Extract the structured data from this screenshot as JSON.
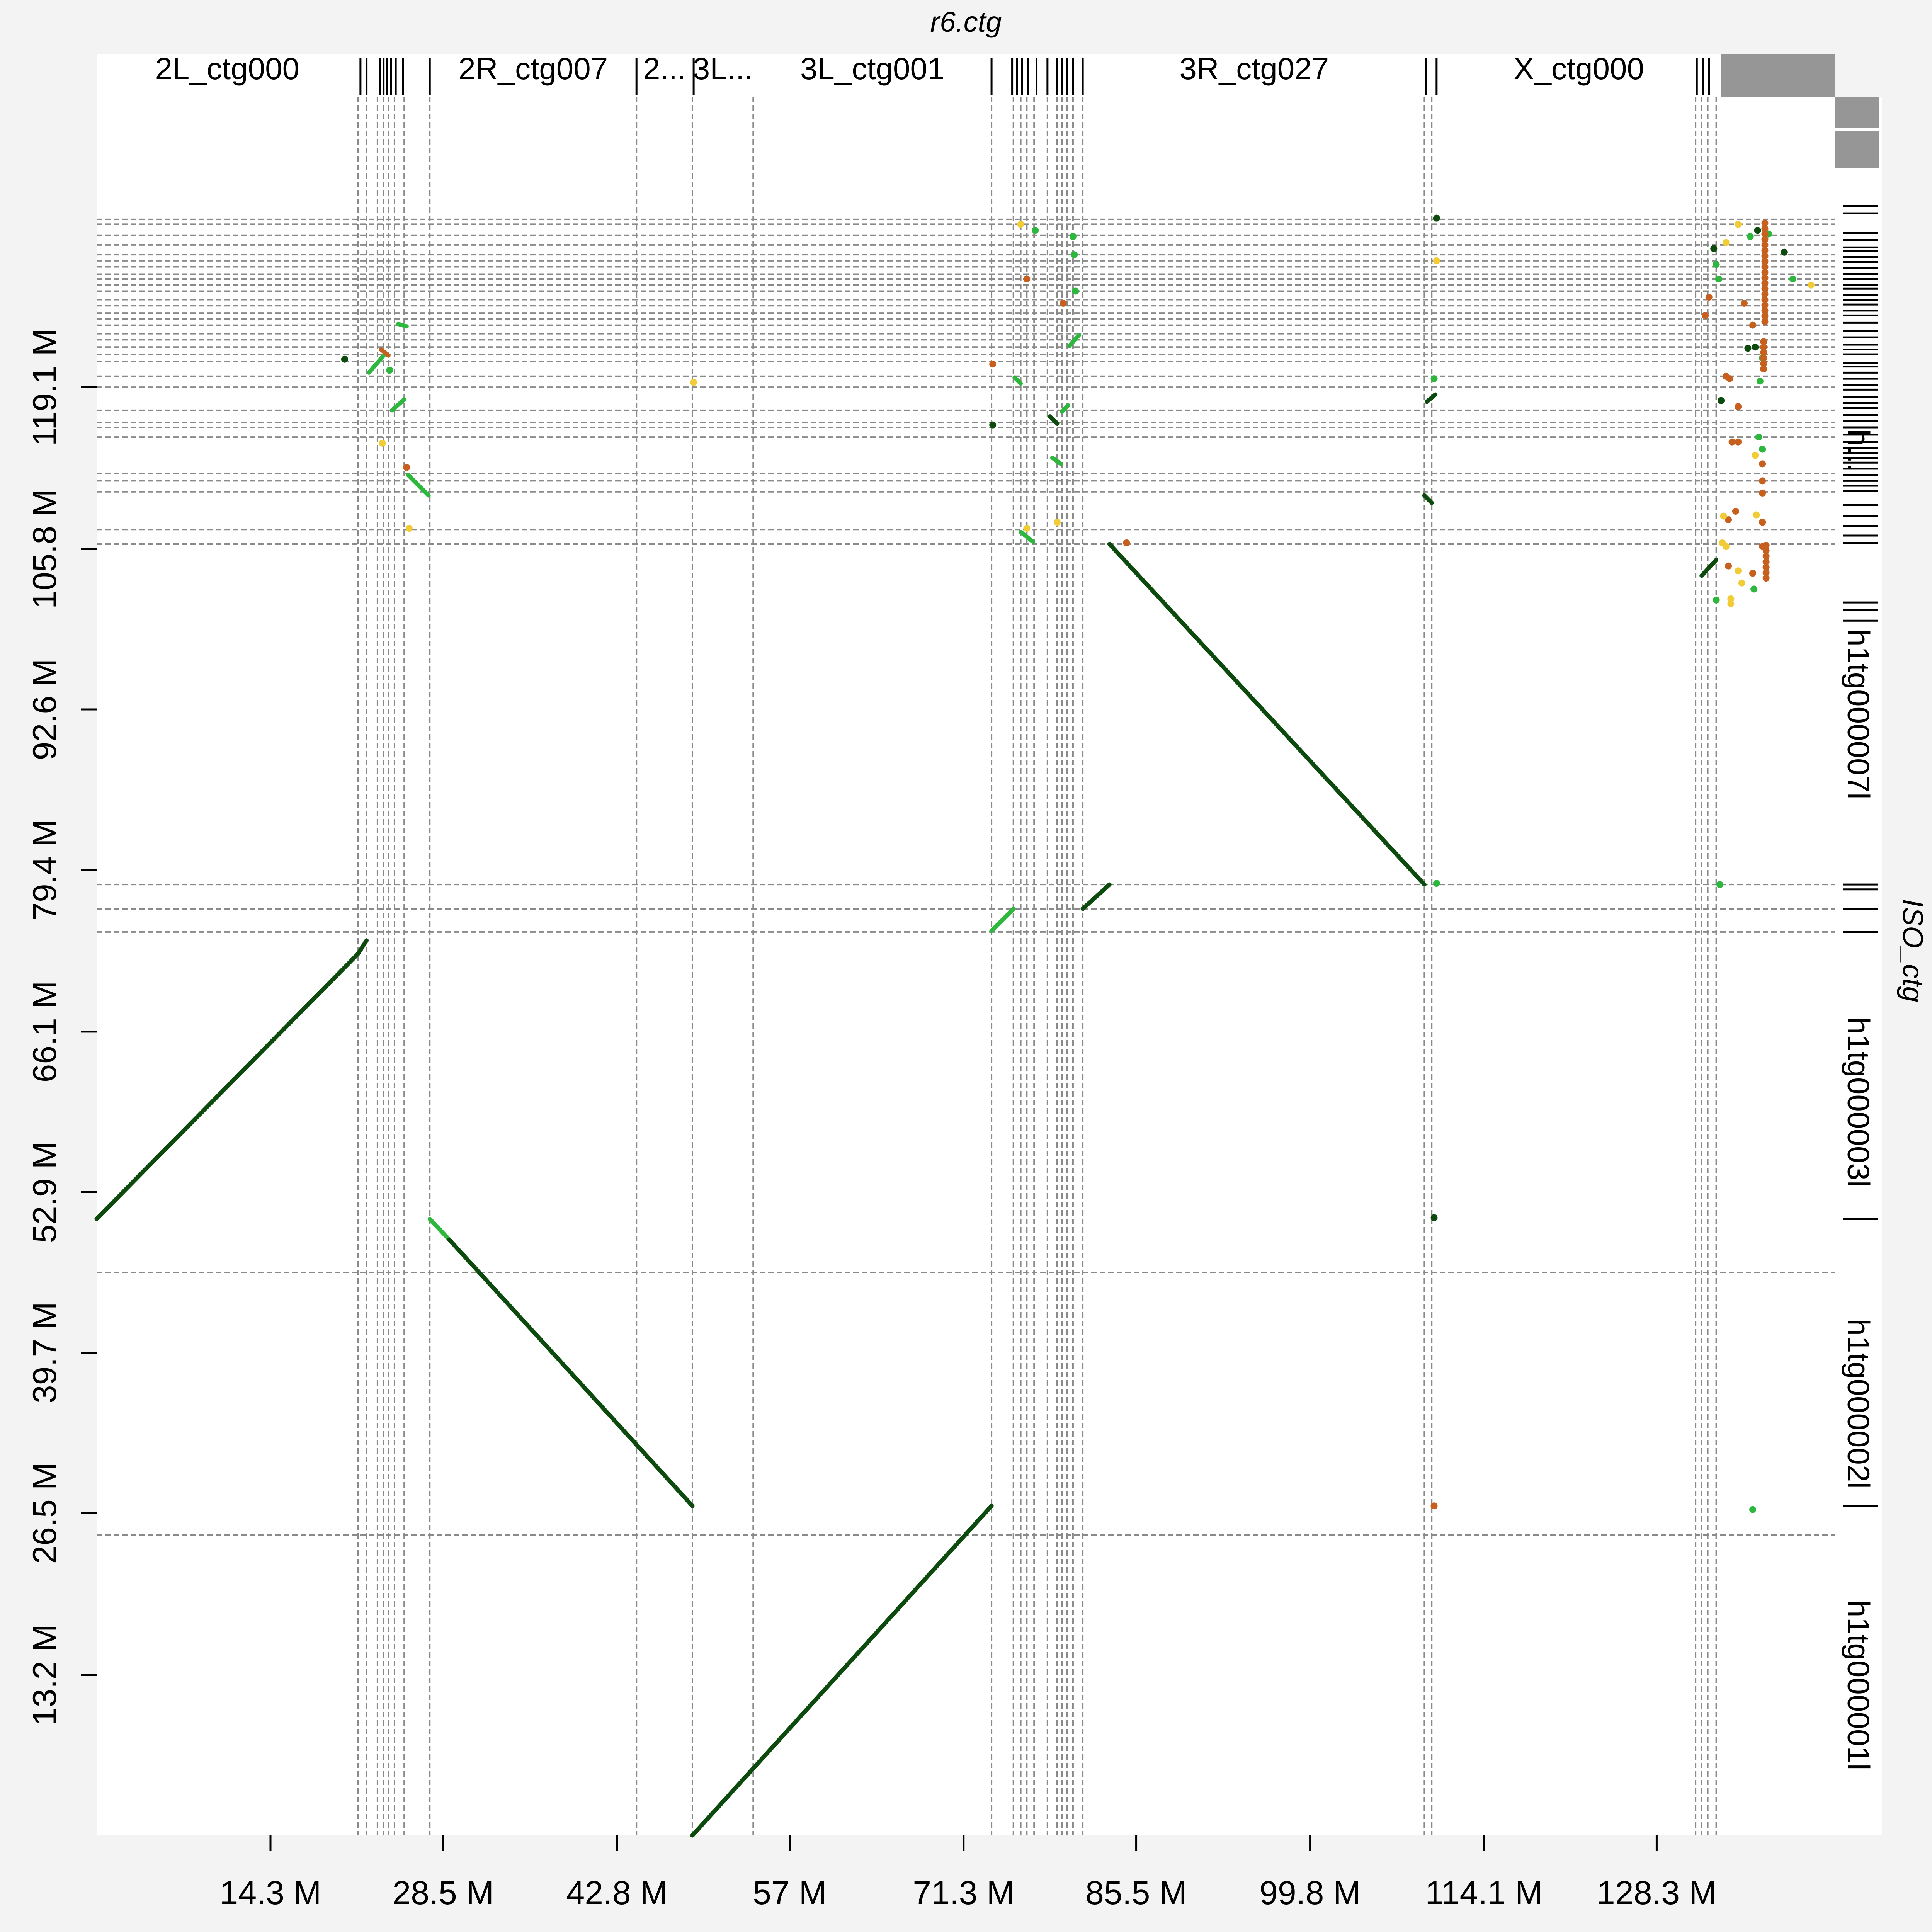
{
  "chart_data": {
    "type": "scatter",
    "title": "r6.ctg",
    "xlabel": "",
    "ylabel": "ISO_ctg",
    "xlim": [
      0,
      143
    ],
    "ylim": [
      0,
      143
    ],
    "x_ticks": [
      {
        "value": 14.3,
        "label": "14.3 M"
      },
      {
        "value": 28.5,
        "label": "28.5 M"
      },
      {
        "value": 42.8,
        "label": "42.8 M"
      },
      {
        "value": 57.0,
        "label": "57 M"
      },
      {
        "value": 71.3,
        "label": "71.3 M"
      },
      {
        "value": 85.5,
        "label": "85.5 M"
      },
      {
        "value": 99.8,
        "label": "99.8 M"
      },
      {
        "value": 114.1,
        "label": "114.1 M"
      },
      {
        "value": 128.3,
        "label": "128.3 M"
      }
    ],
    "y_ticks": [
      {
        "value": 13.2,
        "label": "13.2 M"
      },
      {
        "value": 26.5,
        "label": "26.5 M"
      },
      {
        "value": 39.7,
        "label": "39.7 M"
      },
      {
        "value": 52.9,
        "label": "52.9 M"
      },
      {
        "value": 66.1,
        "label": "66.1 M"
      },
      {
        "value": 79.4,
        "label": "79.4 M"
      },
      {
        "value": 92.6,
        "label": "92.6 M"
      },
      {
        "value": 105.8,
        "label": "105.8 M"
      },
      {
        "value": 119.1,
        "label": "119.1 M"
      }
    ],
    "x_contig_labels": [
      {
        "label": "2L_ctg000",
        "start": 0.0,
        "end": 21.5
      },
      {
        "label": "2R_ctg007",
        "start": 27.4,
        "end": 44.4
      },
      {
        "label": "2...",
        "start": 44.4,
        "end": 49.0
      },
      {
        "label": "3L...",
        "start": 49.0,
        "end": 54.0
      },
      {
        "label": "3L_ctg001",
        "start": 54.0,
        "end": 73.6
      },
      {
        "label": "3R_ctg027",
        "start": 81.1,
        "end": 109.3
      },
      {
        "label": "X_ctg000",
        "start": 110.6,
        "end": 133.2
      }
    ],
    "y_contig_labels": [
      {
        "label": "h1tg000001l",
        "start": 0.0,
        "end": 24.7
      },
      {
        "label": "h1tg000002l",
        "start": 24.7,
        "end": 46.3
      },
      {
        "label": "h1tg000003l",
        "start": 46.3,
        "end": 74.3
      },
      {
        "label": "h1tg000007l",
        "start": 78.2,
        "end": 106.2
      },
      {
        "label": "h...",
        "start": 112.0,
        "end": 115.8
      }
    ],
    "x_boundaries": [
      21.5,
      22.2,
      23.1,
      23.6,
      24.0,
      24.5,
      25.3,
      27.4,
      44.4,
      49.0,
      54.0,
      73.6,
      75.4,
      76.0,
      76.5,
      77.1,
      78.2,
      79.0,
      79.4,
      79.8,
      80.3,
      81.1,
      109.2,
      109.8,
      131.5,
      132.0,
      132.5,
      133.2
    ],
    "y_boundaries": [
      24.7,
      46.3,
      74.3,
      76.2,
      78.2,
      106.2,
      107.4,
      110.5,
      111.4,
      112.0,
      115.0,
      115.8,
      116.2,
      117.2,
      119.1,
      120.0,
      121.2,
      121.8,
      122.4,
      123.0,
      123.5,
      124.2,
      124.7,
      125.2,
      125.8,
      126.3,
      127.0,
      127.5,
      128.0,
      128.4,
      129.0,
      129.5,
      130.0,
      130.8,
      131.6,
      132.5,
      132.9
    ],
    "alignments": [
      {
        "x1": 0.0,
        "y1": 50.7,
        "x2": 21.5,
        "y2": 72.5,
        "color": "#0d4a0d"
      },
      {
        "x1": 21.5,
        "y1": 72.5,
        "x2": 22.2,
        "y2": 73.6,
        "color": "#0d4a0d"
      },
      {
        "x1": 27.4,
        "y1": 50.7,
        "x2": 29.0,
        "y2": 49.0,
        "color": "#2db83d"
      },
      {
        "x1": 29.0,
        "y1": 49.0,
        "x2": 49.0,
        "y2": 27.1,
        "color": "#0d4a0d"
      },
      {
        "x1": 49.0,
        "y1": 0.0,
        "x2": 73.6,
        "y2": 27.1,
        "color": "#0d4a0d"
      },
      {
        "x1": 73.6,
        "y1": 74.4,
        "x2": 75.4,
        "y2": 76.2,
        "color": "#2db83d"
      },
      {
        "x1": 81.1,
        "y1": 76.2,
        "x2": 83.3,
        "y2": 78.2,
        "color": "#0d4a0d"
      },
      {
        "x1": 83.3,
        "y1": 106.2,
        "x2": 109.2,
        "y2": 78.2,
        "color": "#0d4a0d"
      },
      {
        "x1": 109.2,
        "y1": 110.2,
        "x2": 109.8,
        "y2": 109.6,
        "color": "#0d4a0d"
      },
      {
        "x1": 109.4,
        "y1": 117.9,
        "x2": 110.1,
        "y2": 118.5,
        "color": "#0d4a0d"
      },
      {
        "x1": 22.4,
        "y1": 120.3,
        "x2": 23.6,
        "y2": 121.7,
        "color": "#2db83d"
      },
      {
        "x1": 24.8,
        "y1": 124.3,
        "x2": 25.5,
        "y2": 124.1,
        "color": "#2db83d"
      },
      {
        "x1": 24.3,
        "y1": 117.2,
        "x2": 25.3,
        "y2": 118.1,
        "color": "#2db83d"
      },
      {
        "x1": 25.6,
        "y1": 111.9,
        "x2": 27.3,
        "y2": 110.2,
        "color": "#2db83d"
      },
      {
        "x1": 75.5,
        "y1": 119.9,
        "x2": 76.0,
        "y2": 119.4,
        "color": "#2db83d"
      },
      {
        "x1": 76.0,
        "y1": 107.2,
        "x2": 77.0,
        "y2": 106.4,
        "color": "#2db83d"
      },
      {
        "x1": 78.4,
        "y1": 116.7,
        "x2": 79.0,
        "y2": 116.1,
        "color": "#0d4a0d"
      },
      {
        "x1": 78.6,
        "y1": 113.3,
        "x2": 79.3,
        "y2": 112.8,
        "color": "#2db83d"
      },
      {
        "x1": 79.4,
        "y1": 117.1,
        "x2": 79.9,
        "y2": 117.6,
        "color": "#2db83d"
      },
      {
        "x1": 80.0,
        "y1": 122.5,
        "x2": 80.8,
        "y2": 123.4,
        "color": "#2db83d"
      },
      {
        "x1": 132.0,
        "y1": 103.6,
        "x2": 133.2,
        "y2": 104.9,
        "color": "#0d4a0d"
      },
      {
        "x1": 23.4,
        "y1": 122.2,
        "x2": 24.0,
        "y2": 121.7,
        "color": "#c7601e"
      }
    ],
    "dots": [
      {
        "x": 20.4,
        "y": 121.4,
        "color": "#0d4a0d"
      },
      {
        "x": 24.1,
        "y": 120.5,
        "color": "#2db83d"
      },
      {
        "x": 25.5,
        "y": 112.5,
        "color": "#c7601e"
      },
      {
        "x": 25.7,
        "y": 107.5,
        "color": "#f2cc37"
      },
      {
        "x": 23.5,
        "y": 114.5,
        "color": "#f2cc37"
      },
      {
        "x": 49.1,
        "y": 119.5,
        "color": "#f2cc37"
      },
      {
        "x": 73.7,
        "y": 121.0,
        "color": "#c7601e"
      },
      {
        "x": 73.7,
        "y": 116.0,
        "color": "#0d4a0d"
      },
      {
        "x": 77.2,
        "y": 132.0,
        "color": "#2db83d"
      },
      {
        "x": 76.5,
        "y": 128.0,
        "color": "#c7601e"
      },
      {
        "x": 76.0,
        "y": 132.5,
        "color": "#f2cc37"
      },
      {
        "x": 80.3,
        "y": 131.5,
        "color": "#2db83d"
      },
      {
        "x": 80.4,
        "y": 130.0,
        "color": "#2db83d"
      },
      {
        "x": 80.5,
        "y": 127.0,
        "color": "#2db83d"
      },
      {
        "x": 79.5,
        "y": 126.0,
        "color": "#c7601e"
      },
      {
        "x": 79.0,
        "y": 108.0,
        "color": "#f2cc37"
      },
      {
        "x": 76.5,
        "y": 107.5,
        "color": "#f2cc37"
      },
      {
        "x": 84.7,
        "y": 106.3,
        "color": "#c7601e"
      },
      {
        "x": 110.2,
        "y": 133.0,
        "color": "#0d4a0d"
      },
      {
        "x": 110.2,
        "y": 129.5,
        "color": "#f2cc37"
      },
      {
        "x": 110.0,
        "y": 119.8,
        "color": "#2db83d"
      },
      {
        "x": 110.2,
        "y": 78.3,
        "color": "#2db83d"
      },
      {
        "x": 110.0,
        "y": 50.8,
        "color": "#0d4a0d"
      },
      {
        "x": 110.0,
        "y": 27.1,
        "color": "#c7601e"
      },
      {
        "x": 136.2,
        "y": 26.8,
        "color": "#2db83d"
      },
      {
        "x": 133.5,
        "y": 78.2,
        "color": "#2db83d"
      },
      {
        "x": 133.0,
        "y": 130.5,
        "color": "#0d4a0d"
      },
      {
        "x": 133.2,
        "y": 129.2,
        "color": "#2db83d"
      },
      {
        "x": 133.4,
        "y": 128.0,
        "color": "#2db83d"
      },
      {
        "x": 132.6,
        "y": 126.5,
        "color": "#c7601e"
      },
      {
        "x": 132.3,
        "y": 125.0,
        "color": "#c7601e"
      },
      {
        "x": 134.0,
        "y": 131.0,
        "color": "#f2cc37"
      },
      {
        "x": 135.0,
        "y": 132.5,
        "color": "#f2cc37"
      },
      {
        "x": 136.0,
        "y": 131.5,
        "color": "#2db83d"
      },
      {
        "x": 136.6,
        "y": 132.0,
        "color": "#0d4a0d"
      },
      {
        "x": 137.5,
        "y": 131.7,
        "color": "#2db83d"
      },
      {
        "x": 138.8,
        "y": 130.2,
        "color": "#0d4a0d"
      },
      {
        "x": 139.5,
        "y": 128.0,
        "color": "#2db83d"
      },
      {
        "x": 141.0,
        "y": 127.5,
        "color": "#f2cc37"
      },
      {
        "x": 135.5,
        "y": 126.0,
        "color": "#c7601e"
      },
      {
        "x": 136.2,
        "y": 124.2,
        "color": "#c7601e"
      },
      {
        "x": 135.8,
        "y": 122.3,
        "color": "#0d4a0d"
      },
      {
        "x": 136.4,
        "y": 122.4,
        "color": "#0d4a0d"
      },
      {
        "x": 137.0,
        "y": 121.5,
        "color": "#2db83d"
      },
      {
        "x": 136.8,
        "y": 119.6,
        "color": "#2db83d"
      },
      {
        "x": 134.0,
        "y": 120.0,
        "color": "#c7601e"
      },
      {
        "x": 134.3,
        "y": 119.8,
        "color": "#c7601e"
      },
      {
        "x": 133.6,
        "y": 118.0,
        "color": "#0d4a0d"
      },
      {
        "x": 135.0,
        "y": 117.5,
        "color": "#c7601e"
      },
      {
        "x": 134.5,
        "y": 114.6,
        "color": "#c7601e"
      },
      {
        "x": 135.0,
        "y": 114.6,
        "color": "#c7601e"
      },
      {
        "x": 136.7,
        "y": 115.0,
        "color": "#2db83d"
      },
      {
        "x": 137.0,
        "y": 114.0,
        "color": "#2db83d"
      },
      {
        "x": 136.4,
        "y": 113.5,
        "color": "#f2cc37"
      },
      {
        "x": 137.0,
        "y": 112.8,
        "color": "#c7601e"
      },
      {
        "x": 137.0,
        "y": 111.4,
        "color": "#c7601e"
      },
      {
        "x": 137.0,
        "y": 110.4,
        "color": "#c7601e"
      },
      {
        "x": 134.8,
        "y": 108.9,
        "color": "#c7601e"
      },
      {
        "x": 134.2,
        "y": 108.2,
        "color": "#c7601e"
      },
      {
        "x": 133.8,
        "y": 108.5,
        "color": "#f2cc37"
      },
      {
        "x": 133.7,
        "y": 106.3,
        "color": "#f2cc37"
      },
      {
        "x": 134.0,
        "y": 106.0,
        "color": "#f2cc37"
      },
      {
        "x": 136.5,
        "y": 108.6,
        "color": "#f2cc37"
      },
      {
        "x": 137.0,
        "y": 108.0,
        "color": "#c7601e"
      },
      {
        "x": 137.0,
        "y": 106.0,
        "color": "#c7601e"
      },
      {
        "x": 135.0,
        "y": 104.0,
        "color": "#f2cc37"
      },
      {
        "x": 135.3,
        "y": 103.0,
        "color": "#f2cc37"
      },
      {
        "x": 136.2,
        "y": 103.8,
        "color": "#c7601e"
      },
      {
        "x": 136.3,
        "y": 102.5,
        "color": "#2db83d"
      },
      {
        "x": 134.4,
        "y": 101.7,
        "color": "#f2cc37"
      },
      {
        "x": 134.4,
        "y": 101.3,
        "color": "#f2cc37"
      },
      {
        "x": 133.2,
        "y": 101.6,
        "color": "#2db83d"
      },
      {
        "x": 134.2,
        "y": 104.4,
        "color": "#c7601e"
      }
    ],
    "dot_columns": [
      {
        "x": 137.2,
        "y_from": 124.5,
        "y_to": 133.0,
        "color": "#c7601e"
      },
      {
        "x": 137.1,
        "y_from": 120.6,
        "y_to": 123.0,
        "color": "#c7601e"
      },
      {
        "x": 137.3,
        "y_from": 103.4,
        "y_to": 106.2,
        "color": "#c7601e"
      }
    ],
    "right_axis_ticks": [
      134.0,
      133.4,
      131.8,
      131.2,
      130.6,
      130.3,
      129.8,
      129.4,
      128.9,
      128.4,
      128.0,
      127.5,
      127.2,
      126.7,
      126.3,
      125.9,
      125.4,
      125.0,
      124.4,
      123.7,
      123.2,
      122.6,
      122.2,
      121.8,
      121.1,
      120.8,
      120.3,
      119.8,
      119.3,
      118.9,
      118.3,
      117.8,
      117.4,
      116.8,
      116.3,
      115.8,
      115.2,
      114.6,
      114.1,
      113.7,
      113.3,
      112.9,
      112.4,
      111.9,
      111.4,
      111.0,
      110.6,
      109.4,
      108.5,
      107.7,
      106.9,
      106.3,
      101.4,
      100.8,
      99.9,
      78.2,
      77.8,
      76.2,
      74.3,
      50.7,
      27.1
    ],
    "top_axis_ticks": [
      21.7,
      22.2,
      23.3,
      23.6,
      23.9,
      24.2,
      24.6,
      25.2,
      27.4,
      44.4,
      49.1,
      73.6,
      75.3,
      75.7,
      76.1,
      76.6,
      77.3,
      78.2,
      79.0,
      79.4,
      79.8,
      80.3,
      81.1,
      109.3,
      110.2,
      131.6,
      132.1,
      132.6
    ]
  }
}
